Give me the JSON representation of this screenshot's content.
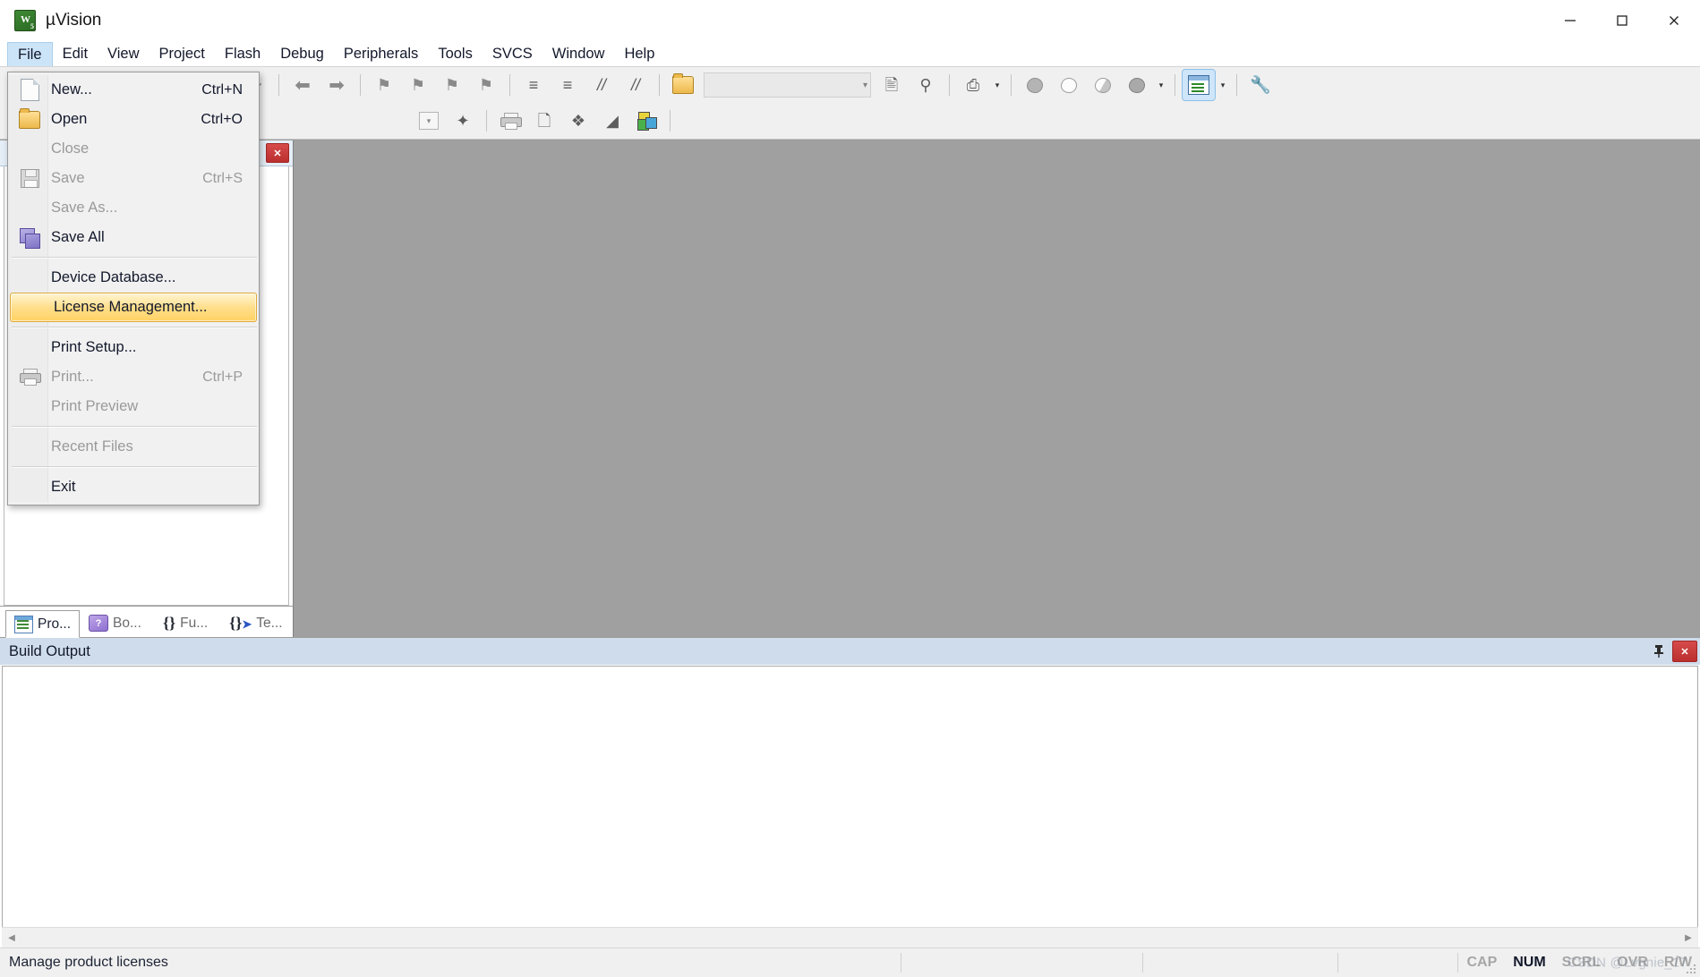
{
  "window": {
    "title": "µVision",
    "icon_name": "uvision-logo",
    "controls": {
      "minimize": "–",
      "maximize": "□",
      "close": "✕"
    }
  },
  "menubar": {
    "items": [
      {
        "label": "File",
        "active": true
      },
      {
        "label": "Edit",
        "active": false
      },
      {
        "label": "View",
        "active": false
      },
      {
        "label": "Project",
        "active": false
      },
      {
        "label": "Flash",
        "active": false
      },
      {
        "label": "Debug",
        "active": false
      },
      {
        "label": "Peripherals",
        "active": false
      },
      {
        "label": "Tools",
        "active": false
      },
      {
        "label": "SVCS",
        "active": false
      },
      {
        "label": "Window",
        "active": false
      },
      {
        "label": "Help",
        "active": false
      }
    ]
  },
  "file_menu": {
    "items": [
      {
        "label": "New...",
        "accel": "Ctrl+N",
        "icon": "new-document-icon",
        "disabled": false,
        "highlight": false
      },
      {
        "label": "Open",
        "accel": "Ctrl+O",
        "icon": "open-folder-icon",
        "disabled": false,
        "highlight": false
      },
      {
        "label": "Close",
        "accel": "",
        "icon": "",
        "disabled": true,
        "highlight": false
      },
      {
        "label": "Save",
        "accel": "Ctrl+S",
        "icon": "save-icon",
        "disabled": true,
        "highlight": false
      },
      {
        "label": "Save As...",
        "accel": "",
        "icon": "",
        "disabled": true,
        "highlight": false
      },
      {
        "label": "Save All",
        "accel": "",
        "icon": "save-all-icon",
        "disabled": false,
        "highlight": false
      },
      {
        "separator": true
      },
      {
        "label": "Device Database...",
        "accel": "",
        "icon": "",
        "disabled": false,
        "highlight": false
      },
      {
        "label": "License Management...",
        "accel": "",
        "icon": "",
        "disabled": false,
        "highlight": true
      },
      {
        "separator": true
      },
      {
        "label": "Print Setup...",
        "accel": "",
        "icon": "",
        "disabled": false,
        "highlight": false
      },
      {
        "label": "Print...",
        "accel": "Ctrl+P",
        "icon": "printer-icon",
        "disabled": true,
        "highlight": false
      },
      {
        "label": "Print Preview",
        "accel": "",
        "icon": "",
        "disabled": true,
        "highlight": false
      },
      {
        "separator": true
      },
      {
        "label": "Recent Files",
        "accel": "",
        "icon": "",
        "disabled": true,
        "highlight": false
      },
      {
        "separator": true
      },
      {
        "label": "Exit",
        "accel": "",
        "icon": "",
        "disabled": false,
        "highlight": false
      }
    ]
  },
  "toolbar": {
    "combo_value": "",
    "combo_placeholder": "",
    "row1_icons": [
      "undo-icon",
      "redo-icon",
      "navigate-back-icon",
      "navigate-forward-icon",
      "bookmark-toggle-icon",
      "bookmark-prev-icon",
      "bookmark-next-icon",
      "bookmark-clear-icon",
      "indent-icon",
      "outdent-icon",
      "comment-icon",
      "uncomment-icon",
      "find-in-files-icon",
      "insert-file-icon",
      "find-next-icon",
      "browse-symbol-icon",
      "build-filled-icon",
      "build-hollow-icon",
      "build-half-icon",
      "build-dark-icon",
      "target-window-icon",
      "configure-icon"
    ],
    "row2_icons": [
      "dropdown-icon",
      "magic-wand-icon",
      "printer-icon",
      "print-multi-icon",
      "move-icon",
      "landscape-icon",
      "color-cube-icon"
    ]
  },
  "left_pane": {
    "close_label": "✕",
    "tabs": [
      {
        "label": "Pro...",
        "icon": "project-icon",
        "selected": true
      },
      {
        "label": "Bo...",
        "icon": "books-icon",
        "selected": false
      },
      {
        "label": "Fu...",
        "icon": "functions-icon",
        "selected": false
      },
      {
        "label": "Te...",
        "icon": "templates-icon",
        "selected": false
      }
    ]
  },
  "build_output": {
    "title": "Build Output",
    "pin_label": "📌",
    "close_label": "✕",
    "content": ""
  },
  "statusbar": {
    "message": "Manage product licenses",
    "indicators": [
      {
        "label": "CAP",
        "on": false
      },
      {
        "label": "NUM",
        "on": true
      },
      {
        "label": "SCRL",
        "on": false
      },
      {
        "label": "OVR",
        "on": false
      },
      {
        "label": "R/W",
        "on": false
      }
    ],
    "watermark": "CSDN @Lvgnie_17"
  },
  "colors": {
    "menu_active": "#cce4f7",
    "highlight_start": "#fff5d3",
    "highlight_end": "#ffd263",
    "highlight_border": "#e0a93c",
    "pane_header": "#e5eef7",
    "build_header": "#cfdceb",
    "close_red": "#bb2f2f",
    "workspace_gray": "#a0a0a0"
  }
}
